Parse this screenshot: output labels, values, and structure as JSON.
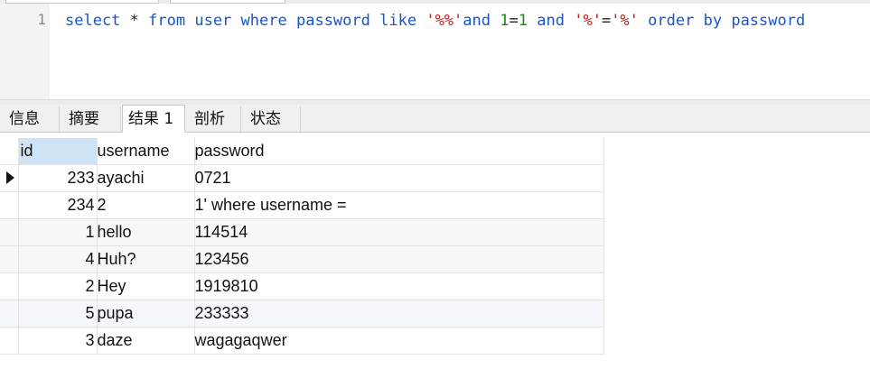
{
  "editor": {
    "line_number": "1",
    "tokens": {
      "kw_select": "select",
      "star": " * ",
      "kw_from": "from",
      "sp1": " ",
      "kw_user": "user",
      "sp2": " ",
      "kw_where": "where",
      "sp3": " ",
      "kw_password": "password",
      "sp4": " ",
      "kw_like": "like",
      "sp5": " ",
      "str_pct": "'%%'",
      "kw_and1": "and",
      "sp6": " ",
      "num_1a": "1",
      "eq1": "=",
      "num_1b": "1",
      "sp7": " ",
      "kw_and2": "and",
      "sp8": " ",
      "str_p1": "'%'",
      "eq2": "=",
      "str_p2": "'%'",
      "sp9": " ",
      "kw_order": "order",
      "sp10": " ",
      "kw_by": "by",
      "sp11": " ",
      "kw_password2": "password"
    }
  },
  "tabs": [
    {
      "label": "信息"
    },
    {
      "label": "摘要"
    },
    {
      "label": "结果 1"
    },
    {
      "label": "剖析"
    },
    {
      "label": "状态"
    }
  ],
  "grid": {
    "columns": [
      "id",
      "username",
      "password"
    ],
    "rows": [
      {
        "id": "233",
        "username": "ayachi",
        "password": "0721"
      },
      {
        "id": "234",
        "username": "2",
        "password": "1' where username ="
      },
      {
        "id": "1",
        "username": "hello",
        "password": "114514"
      },
      {
        "id": "4",
        "username": "Huh?",
        "password": "123456"
      },
      {
        "id": "2",
        "username": "Hey",
        "password": "1919810"
      },
      {
        "id": "5",
        "username": "pupa",
        "password": "233333"
      },
      {
        "id": "3",
        "username": "daze",
        "password": "wagagaqwer"
      }
    ]
  }
}
